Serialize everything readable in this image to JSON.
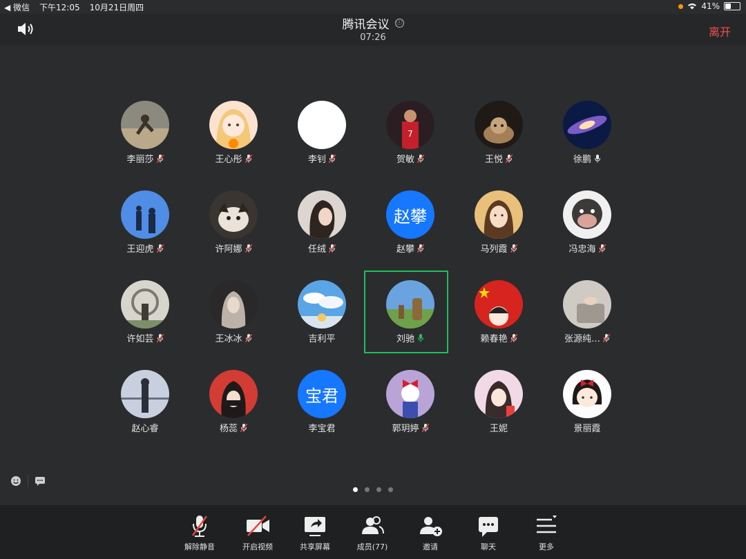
{
  "status_bar": {
    "back_app": "◀ 微信",
    "time": "下午12:05",
    "date": "10月21日周四",
    "battery": "41%",
    "battery_level": 0.41
  },
  "header": {
    "title": "腾讯会议",
    "timer": "07:26",
    "leave_label": "离开",
    "info_icon": "ⓘ"
  },
  "participants": [
    {
      "name": "李丽莎",
      "mic": "muted"
    },
    {
      "name": "王心彤",
      "mic": "muted"
    },
    {
      "name": "李钊",
      "mic": "muted"
    },
    {
      "name": "贺敏",
      "mic": "muted"
    },
    {
      "name": "王悦",
      "mic": "muted"
    },
    {
      "name": "徐鹏",
      "mic": "on"
    },
    {
      "name": "王迎虎",
      "mic": "muted"
    },
    {
      "name": "许阿娜",
      "mic": "muted"
    },
    {
      "name": "任绒",
      "mic": "muted"
    },
    {
      "name": "赵攀",
      "mic": "muted",
      "avatar_text": "赵攀"
    },
    {
      "name": "马列霞",
      "mic": "muted"
    },
    {
      "name": "冯忠海",
      "mic": "muted"
    },
    {
      "name": "许如芸",
      "mic": "muted"
    },
    {
      "name": "王冰冰",
      "mic": "muted"
    },
    {
      "name": "吉利平",
      "mic": "none"
    },
    {
      "name": "刘驰",
      "mic": "speaking",
      "highlight": true
    },
    {
      "name": "赖春艳",
      "mic": "muted"
    },
    {
      "name": "张源纯…",
      "mic": "muted"
    },
    {
      "name": "赵心睿",
      "mic": "none"
    },
    {
      "name": "杨蕊",
      "mic": "muted"
    },
    {
      "name": "李宝君",
      "mic": "none",
      "avatar_text": "宝君"
    },
    {
      "name": "郭玥婷",
      "mic": "muted"
    },
    {
      "name": "王妮",
      "mic": "none"
    },
    {
      "name": "景丽霞",
      "mic": "none"
    }
  ],
  "pagination": {
    "total": 4,
    "current": 0
  },
  "toolbar": [
    {
      "label": "解除静音",
      "icon": "mic-off-icon"
    },
    {
      "label": "开启视频",
      "icon": "video-off-icon"
    },
    {
      "label": "共享屏幕",
      "icon": "share-screen-icon"
    },
    {
      "label": "成员(77)",
      "icon": "members-icon"
    },
    {
      "label": "邀请",
      "icon": "invite-icon"
    },
    {
      "label": "聊天",
      "icon": "chat-icon"
    },
    {
      "label": "更多",
      "icon": "more-icon"
    }
  ],
  "colors": {
    "accent_green": "#1fbf5e",
    "leave_red": "#f0524a",
    "mute_red": "#e8453c",
    "text_avatar_blue": "#1677ff"
  }
}
